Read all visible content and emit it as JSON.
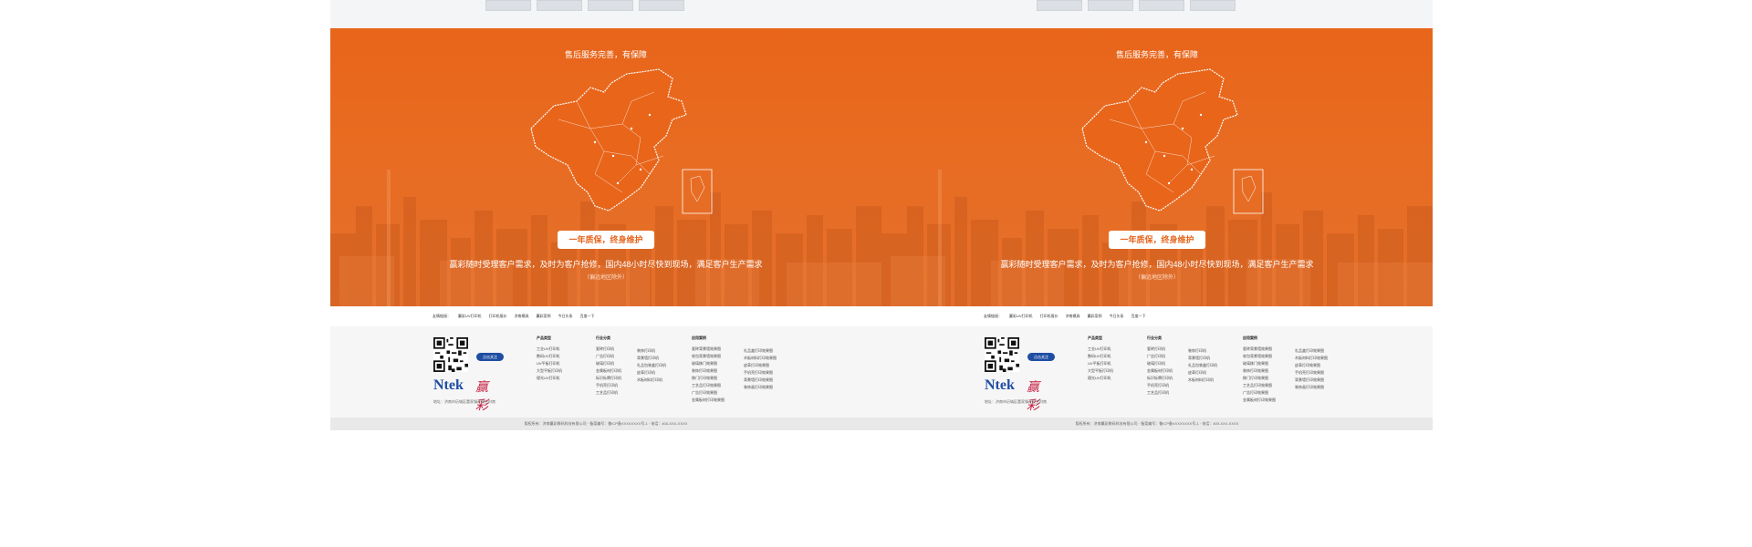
{
  "panels": [
    {
      "hero": {
        "title": "售后服务完善，有保障",
        "badge": "一年质保，终身维护",
        "description": "赢彩随时受理客户需求，及时为客户抢修，国内48小时尽快到现场，满足客户生产需求",
        "note": "（偏远地区除外）"
      },
      "friend_links": {
        "label": "友情链接：",
        "items": [
          "赢彩UV打印机",
          "打印机报价",
          "济南模具",
          "赢彩案例",
          "今日头条",
          "百度一下"
        ]
      },
      "footer": {
        "follow_label": "点击关注",
        "logo_text": "Ntek",
        "logo_cn": "赢彩",
        "address": "地址：济南市历城区董家镇孙家庄村南",
        "columns": [
          {
            "title": "产品类型",
            "items": [
              "工业UV打印机",
              "数码UV打印机",
              "UV平板打印机",
              "大型平板打印机",
              "理光UV打印机"
            ]
          },
          {
            "title": "行业分类",
            "items": [
              "瓷砖打印机",
              "广告打印机",
              "玻璃打印机",
              "金属板材打印机",
              "标识标牌打印机",
              "手机壳打印机",
              "工艺品打印机"
            ]
          },
          {
            "title": "",
            "items": [
              "装饰打印机",
              "背景墙打印机",
              "礼品包装盒打印机",
              "皮革打印机",
              "木板材料打印机"
            ]
          },
          {
            "title": "应用案例",
            "items": [
              "瓷砖背景墙效果图",
              "软包背景墙效果图",
              "玻璃移门效果图",
              "装饰打印效果图",
              "移门打印效果图",
              "工艺品打印效果图",
              "广告打印效果图",
              "金属板材打印效果图"
            ]
          },
          {
            "title": "",
            "items": [
              "礼品盒打印效果图",
              "木板材料打印效果图",
              "皮革打印效果图",
              "手机壳打印效果图",
              "背景墙打印效果图",
              "装饰画打印效果图"
            ]
          }
        ],
        "copyright": "版权所有：济南赢彩数码科技有限公司 · 备案编号：鲁ICP备XXXXXXXX号-1 · 电话：400-XXX-XXXX"
      }
    },
    {
      "hero": {
        "title": "售后服务完善，有保障",
        "badge": "一年质保，终身维护",
        "description": "赢彩随时受理客户需求，及时为客户抢修，国内48小时尽快到现场，满足客户生产需求",
        "note": "（偏远地区除外）"
      },
      "friend_links": {
        "label": "友情链接：",
        "items": [
          "赢彩UV打印机",
          "打印机报价",
          "济南模具",
          "赢彩案例",
          "今日头条",
          "百度一下"
        ]
      },
      "footer": {
        "follow_label": "点击关注",
        "logo_text": "Ntek",
        "logo_cn": "赢彩",
        "address": "地址：济南市历城区董家镇孙家庄村南",
        "columns": [
          {
            "title": "产品类型",
            "items": [
              "工业UV打印机",
              "数码UV打印机",
              "UV平板打印机",
              "大型平板打印机",
              "理光UV打印机"
            ]
          },
          {
            "title": "行业分类",
            "items": [
              "瓷砖打印机",
              "广告打印机",
              "玻璃打印机",
              "金属板材打印机",
              "标识标牌打印机",
              "手机壳打印机",
              "工艺品打印机"
            ]
          },
          {
            "title": "",
            "items": [
              "装饰打印机",
              "背景墙打印机",
              "礼品包装盒打印机",
              "皮革打印机",
              "木板材料打印机"
            ]
          },
          {
            "title": "应用案例",
            "items": [
              "瓷砖背景墙效果图",
              "软包背景墙效果图",
              "玻璃移门效果图",
              "装饰打印效果图",
              "移门打印效果图",
              "工艺品打印效果图",
              "广告打印效果图",
              "金属板材打印效果图"
            ]
          },
          {
            "title": "",
            "items": [
              "礼品盒打印效果图",
              "木板材料打印效果图",
              "皮革打印效果图",
              "手机壳打印效果图",
              "背景墙打印效果图",
              "装饰画打印效果图"
            ]
          }
        ],
        "copyright": "版权所有：济南赢彩数码科技有限公司 · 备案编号：鲁ICP备XXXXXXXX号-1 · 电话：400-XXX-XXXX"
      }
    }
  ],
  "colors": {
    "hero_orange": "#e8651a",
    "brand_blue": "#1f4ea3",
    "brand_red": "#c71c3f",
    "badge_text": "#e5631b"
  }
}
